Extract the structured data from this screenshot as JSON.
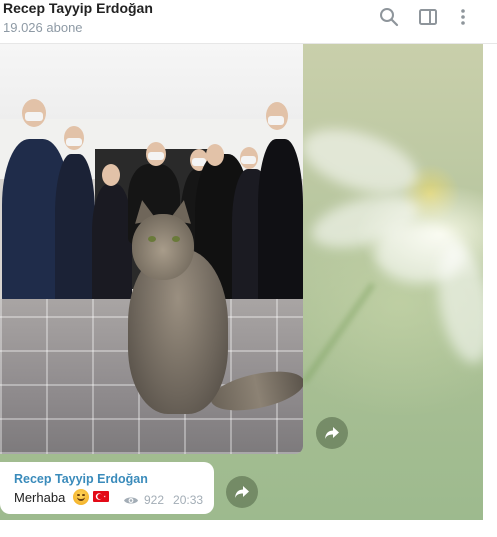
{
  "header": {
    "title": "Recep Tayyip Erdoğan",
    "subtitle": "19.026 abone",
    "icons": [
      "search-icon",
      "sidebar-toggle-icon",
      "more-vertical-icon"
    ]
  },
  "photo_post": {
    "share_icon": "share-arrow-icon"
  },
  "message": {
    "sender": "Recep Tayyip Erdoğan",
    "text": "Merhaba",
    "emojis": [
      "smiling-face",
      "turkey-flag"
    ],
    "views": "922",
    "time": "20:33",
    "share_icon": "share-arrow-icon"
  },
  "colors": {
    "sender_name": "#3a8bbb",
    "meta": "#a3adb6",
    "header_subtitle": "#8e9aa5"
  }
}
